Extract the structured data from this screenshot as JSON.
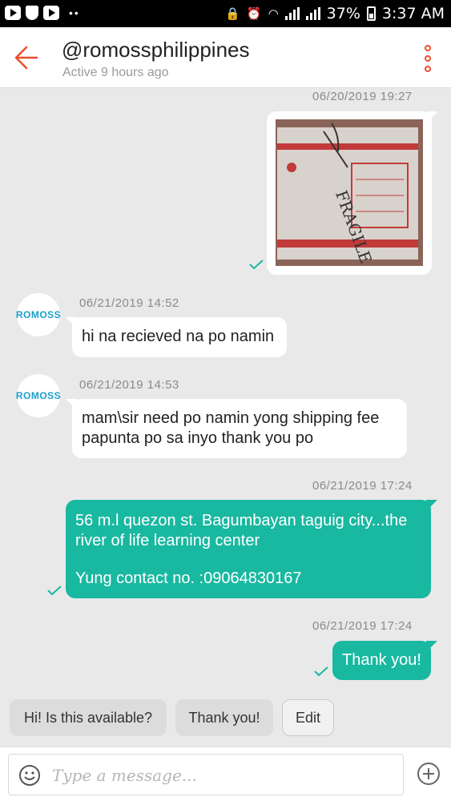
{
  "status_bar": {
    "left_icons": [
      "youtube-icon",
      "shield-icon",
      "youtube-icon"
    ],
    "right_text": "37%",
    "time": "3:37 AM"
  },
  "header": {
    "title": "@romossphilippines",
    "subtitle": "Active 9 hours ago"
  },
  "messages": [
    {
      "type": "image",
      "direction": "out",
      "timestamp": "06/20/2019 19:27",
      "image_text": "FRAGILE"
    },
    {
      "type": "text",
      "direction": "in",
      "timestamp": "06/21/2019 14:52",
      "sender_avatar": "ROMOSS",
      "text": "hi na recieved na po namin"
    },
    {
      "type": "text",
      "direction": "in",
      "timestamp": "06/21/2019 14:53",
      "sender_avatar": "ROMOSS",
      "lines": [
        "mam\\sir need po namin yong shipping fee",
        "papunta po sa inyo thank you po"
      ]
    },
    {
      "type": "text",
      "direction": "out",
      "timestamp": "06/21/2019 17:24",
      "lines": [
        "56 m.l quezon st. Bagumbayan taguig city...the",
        "river of life learning center",
        "",
        "Yung contact no. :09064830167"
      ]
    },
    {
      "type": "text",
      "direction": "out",
      "timestamp": "06/21/2019 17:24",
      "text": "Thank you!"
    }
  ],
  "quick_replies": [
    "Hi! Is this available?",
    "Thank you!",
    "Edit"
  ],
  "input": {
    "placeholder": "Type a message..."
  },
  "colors": {
    "accent": "#ee4d2d",
    "outgoing_bubble": "#19b8a0",
    "check": "#19b8a0"
  }
}
